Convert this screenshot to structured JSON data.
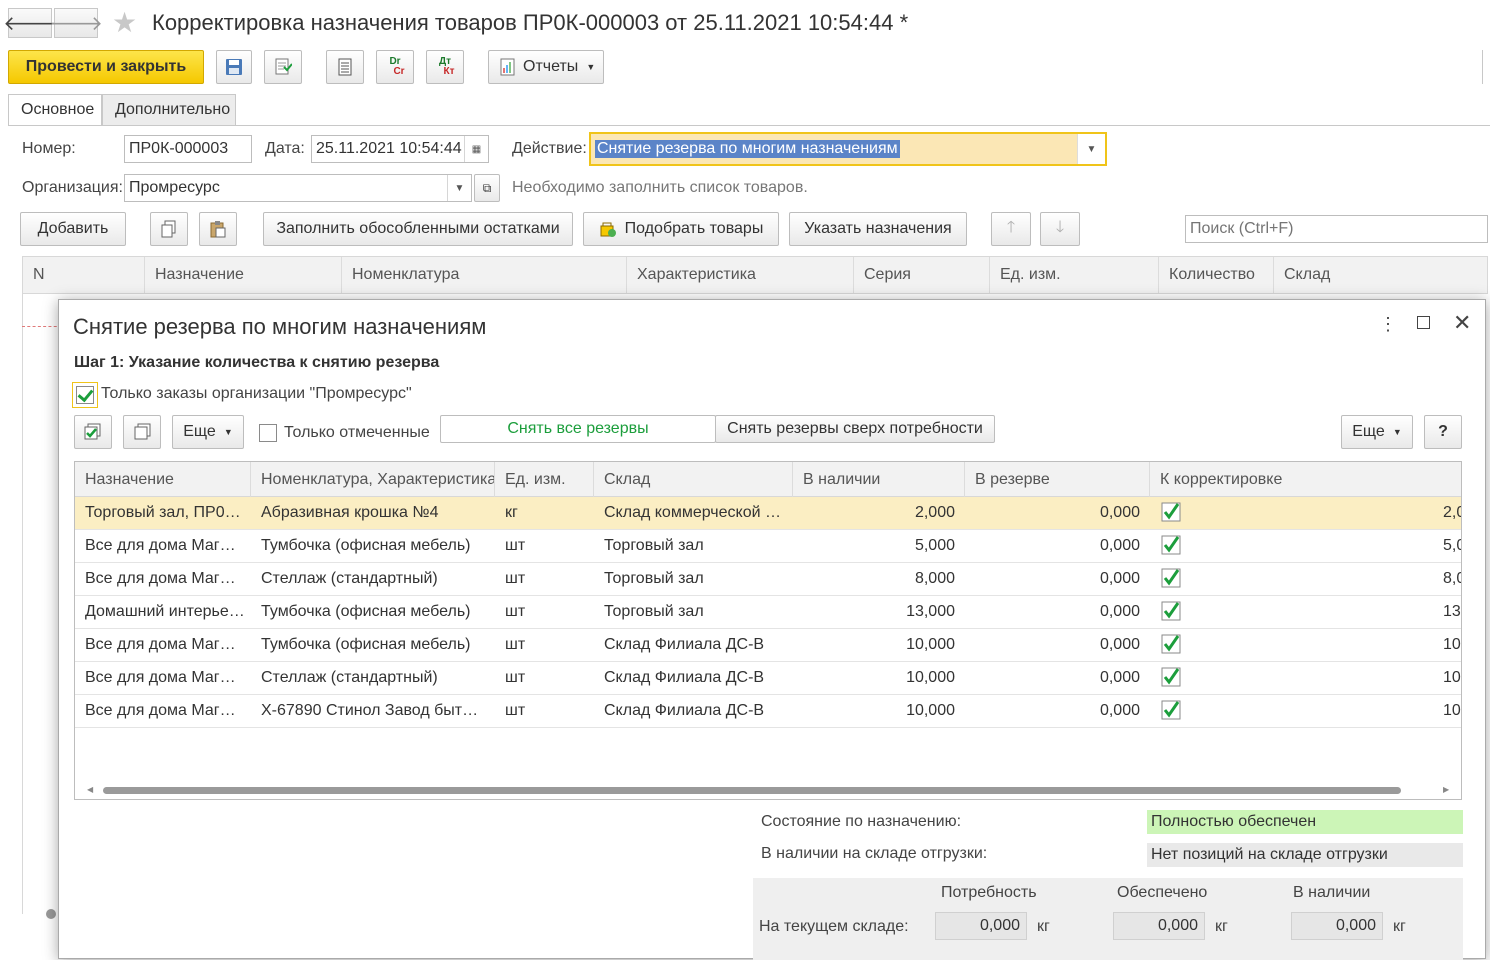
{
  "window": {
    "title": "Корректировка назначения товаров ПР0К-000003 от 25.11.2021 10:54:44 *"
  },
  "toolbar": {
    "post_close": "Провести и закрыть",
    "reports": "Отчеты",
    "dtkt_dr": "Dr",
    "dtkt_cr": "Cr",
    "dtkt_dt": "Дт",
    "dtkt_kt": "Кт"
  },
  "tabs": [
    "Основное",
    "Дополнительно"
  ],
  "form": {
    "number_label": "Номер:",
    "number_value": "ПР0К-000003",
    "date_label": "Дата:",
    "date_value": "25.11.2021 10:54:44",
    "action_label": "Действие:",
    "action_value": "Снятие резерва по многим назначениям",
    "org_label": "Организация:",
    "org_value": "Промресурс",
    "hint": "Необходимо заполнить список товаров."
  },
  "list_toolbar": {
    "add": "Добавить",
    "fill_separate": "Заполнить обособленными остатками",
    "pick_goods": "Подобрать товары",
    "set_purpose": "Указать назначения",
    "search_placeholder": "Поиск (Ctrl+F)"
  },
  "main_table": {
    "columns": [
      "N",
      "Назначение",
      "Номенклатура",
      "Характеристика",
      "Серия",
      "Ед. изм.",
      "Количество",
      "Склад"
    ]
  },
  "dialog": {
    "title": "Снятие резерва по многим назначениям",
    "step": "Шаг 1: Указание количества к снятию резерва",
    "only_org_orders": "Только заказы организации \"Промресурс\"",
    "more": "Еще",
    "only_marked": "Только отмеченные",
    "remove_all": "Снять все резервы",
    "remove_above_need": "Снять резервы сверх потребности",
    "help": "?",
    "columns": [
      "Назначение",
      "Номенклатура, Характеристика",
      "Ед. изм.",
      "Склад",
      "В наличии",
      "В резерве",
      "К корректировке"
    ],
    "rows": [
      {
        "purpose": "Торговый зал, ПР0…",
        "item": "Абразивная крошка №4",
        "unit": "кг",
        "warehouse": "Склад коммерческой …",
        "available": "2,000",
        "reserved": "0,000",
        "checked": true,
        "adjust": "2,0"
      },
      {
        "purpose": "Все для дома Маг…",
        "item": "Тумбочка (офисная мебель)",
        "unit": "шт",
        "warehouse": "Торговый зал",
        "available": "5,000",
        "reserved": "0,000",
        "checked": true,
        "adjust": "5,0"
      },
      {
        "purpose": "Все для дома Маг…",
        "item": "Стеллаж (стандартный)",
        "unit": "шт",
        "warehouse": "Торговый зал",
        "available": "8,000",
        "reserved": "0,000",
        "checked": true,
        "adjust": "8,0"
      },
      {
        "purpose": "Домашний интерье…",
        "item": "Тумбочка (офисная мебель)",
        "unit": "шт",
        "warehouse": "Торговый зал",
        "available": "13,000",
        "reserved": "0,000",
        "checked": true,
        "adjust": "13,0"
      },
      {
        "purpose": "Все для дома Маг…",
        "item": "Тумбочка (офисная мебель)",
        "unit": "шт",
        "warehouse": "Склад Филиала ДС-В",
        "available": "10,000",
        "reserved": "0,000",
        "checked": true,
        "adjust": "10,0"
      },
      {
        "purpose": "Все для дома Маг…",
        "item": "Стеллаж (стандартный)",
        "unit": "шт",
        "warehouse": "Склад Филиала ДС-В",
        "available": "10,000",
        "reserved": "0,000",
        "checked": true,
        "adjust": "10,0"
      },
      {
        "purpose": "Все для дома Маг…",
        "item": "Х-67890 Стинол Завод быт…",
        "unit": "шт",
        "warehouse": "Склад Филиала ДС-В",
        "available": "10,000",
        "reserved": "0,000",
        "checked": true,
        "adjust": "10,0"
      }
    ],
    "state_label": "Состояние по назначению:",
    "state_value": "Полностью обеспечен",
    "stock_label": "В наличии на складе отгрузки:",
    "stock_value": "Нет позиций на складе отгрузки",
    "summary": {
      "need_label": "Потребность",
      "provided_label": "Обеспечено",
      "available_label": "В наличии",
      "row_label": "На текущем складе:",
      "need_value": "0,000",
      "provided_value": "0,000",
      "available_value": "0,000",
      "unit": "кг"
    }
  },
  "colors": {
    "primary_button": "#f5c800",
    "selected_row": "#fbeec3",
    "status_ok": "#ccf5b7",
    "check_green": "#1c9e3c",
    "remove_all_text": "#1c9e3c"
  }
}
